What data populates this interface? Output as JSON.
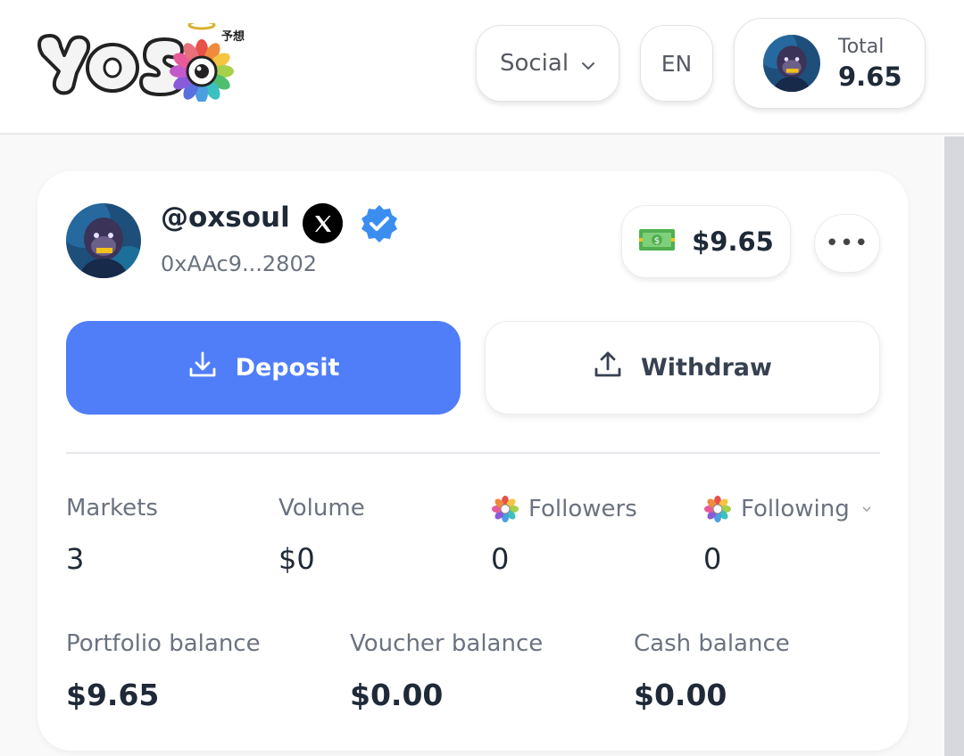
{
  "header": {
    "logo_text": "yos",
    "logo_sub": "予想",
    "category_select": "Social",
    "language": "EN",
    "total_label": "Total",
    "total_value": "9.65"
  },
  "profile": {
    "username": "@oxsoul",
    "address": "0xAAc9...2802",
    "cash_amount": "$9.65",
    "more_label": "•••",
    "deposit_label": "Deposit",
    "withdraw_label": "Withdraw"
  },
  "stats": [
    {
      "label": "Markets",
      "value": "3"
    },
    {
      "label": "Volume",
      "value": "$0"
    },
    {
      "label": "Followers",
      "value": "0"
    },
    {
      "label": "Following",
      "value": "0"
    }
  ],
  "balances": [
    {
      "label": "Portfolio balance",
      "value": "$9.65"
    },
    {
      "label": "Voucher balance",
      "value": "$0.00"
    },
    {
      "label": "Cash balance",
      "value": "$0.00"
    }
  ],
  "colors": {
    "primary": "#507ef9",
    "verified": "#3b8ef0",
    "text": "#1f2937",
    "muted": "#6b7280"
  },
  "icons": [
    "chevron-down-icon",
    "x-logo-icon",
    "verified-badge-icon",
    "money-icon",
    "more-icon",
    "download-icon",
    "upload-icon",
    "flower-icon"
  ]
}
